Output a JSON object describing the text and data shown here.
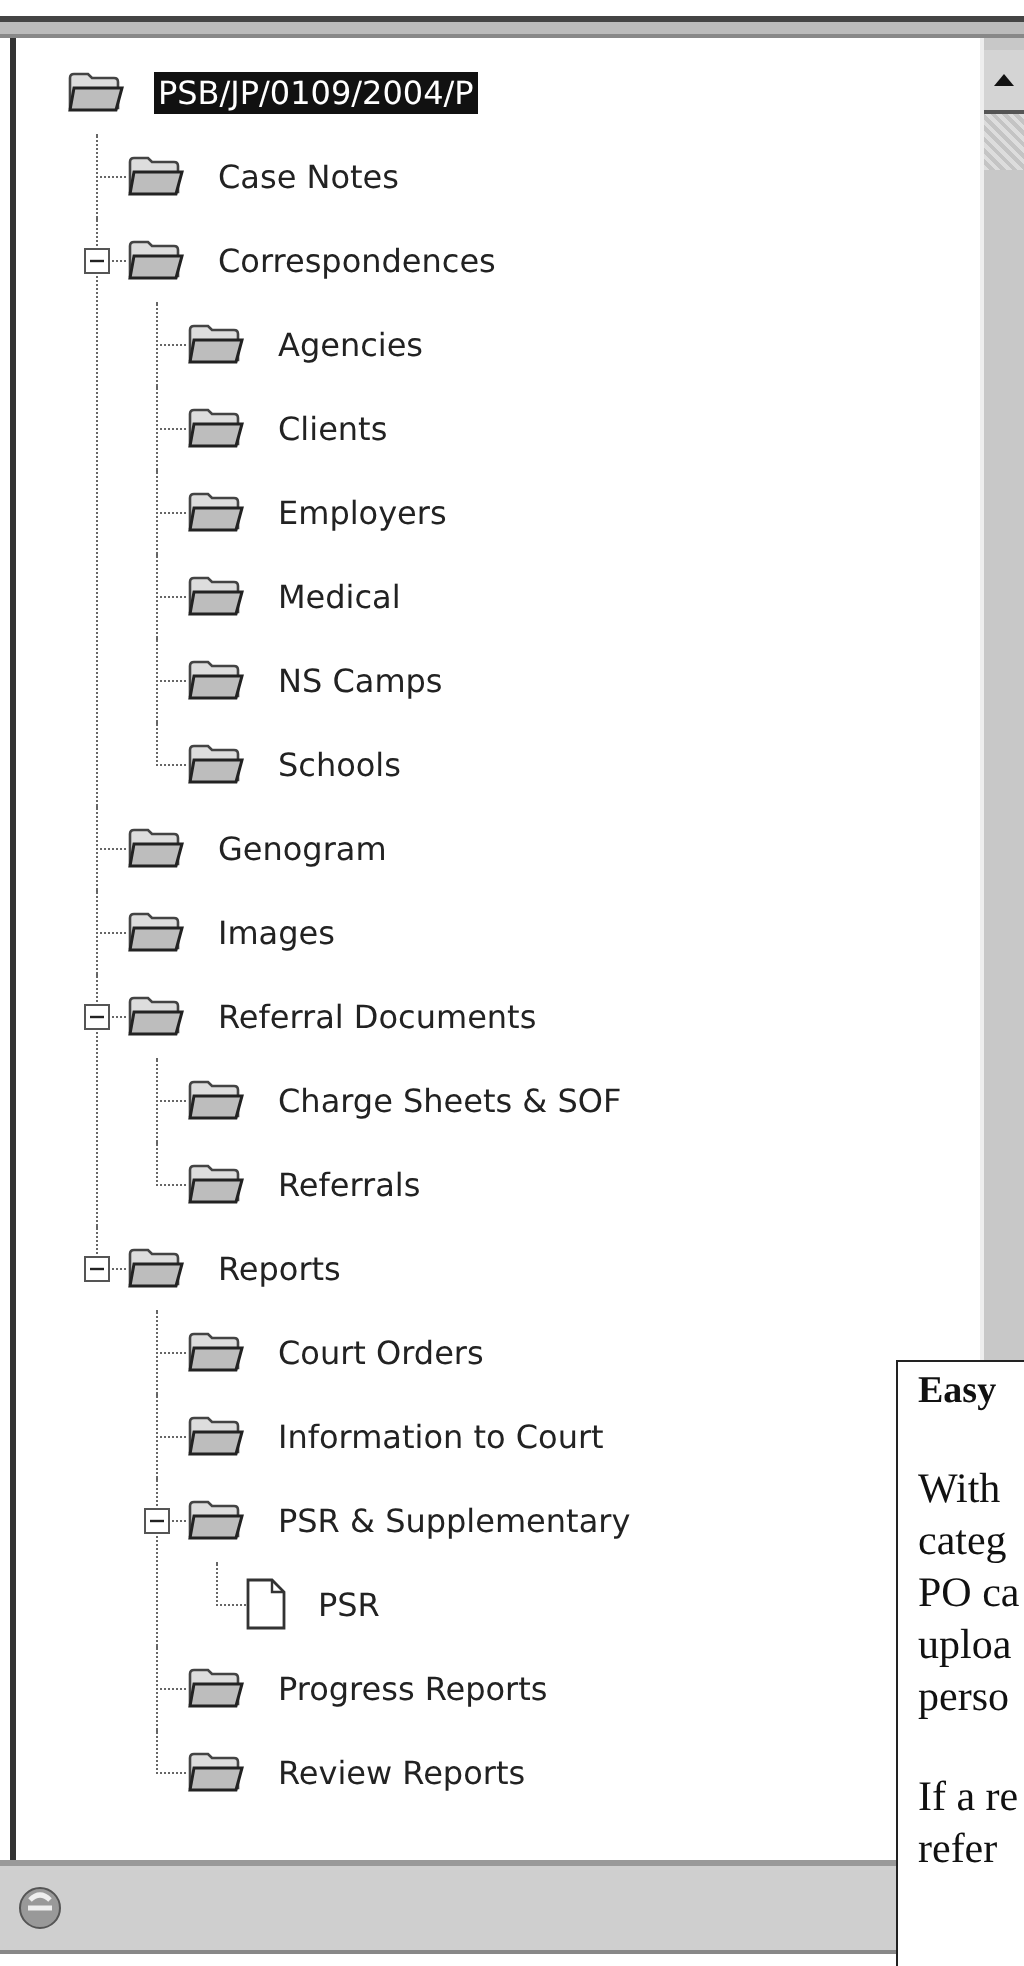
{
  "tree": {
    "label": "PSB/JP/0109/2004/P",
    "kind": "folder",
    "selected": true,
    "children": [
      {
        "label": "Case Notes",
        "kind": "folder",
        "selected": false
      },
      {
        "label": "Correspondences",
        "kind": "folder",
        "selected": false,
        "expanded": true,
        "children": [
          {
            "label": "Agencies",
            "kind": "folder",
            "selected": false
          },
          {
            "label": "Clients",
            "kind": "folder",
            "selected": false
          },
          {
            "label": "Employers",
            "kind": "folder",
            "selected": false
          },
          {
            "label": "Medical",
            "kind": "folder",
            "selected": false
          },
          {
            "label": "NS Camps",
            "kind": "folder",
            "selected": false
          },
          {
            "label": "Schools",
            "kind": "folder",
            "selected": false
          }
        ]
      },
      {
        "label": "Genogram",
        "kind": "folder",
        "selected": false
      },
      {
        "label": "Images",
        "kind": "folder",
        "selected": false
      },
      {
        "label": "Referral Documents",
        "kind": "folder",
        "selected": false,
        "expanded": true,
        "children": [
          {
            "label": "Charge Sheets & SOF",
            "kind": "folder",
            "selected": false
          },
          {
            "label": "Referrals",
            "kind": "folder",
            "selected": false
          }
        ]
      },
      {
        "label": "Reports",
        "kind": "folder",
        "selected": false,
        "expanded": true,
        "children": [
          {
            "label": "Court Orders",
            "kind": "folder",
            "selected": false
          },
          {
            "label": "Information to Court",
            "kind": "folder",
            "selected": false
          },
          {
            "label": "PSR & Supplementary",
            "kind": "folder",
            "selected": false,
            "expanded": true,
            "children": [
              {
                "label": "PSR",
                "kind": "document",
                "selected": false
              }
            ]
          },
          {
            "label": "Progress Reports",
            "kind": "folder",
            "selected": false
          },
          {
            "label": "Review Reports",
            "kind": "folder",
            "selected": false
          }
        ]
      }
    ]
  },
  "callout": {
    "title": "Easy",
    "paragraphs": [
      [
        "With",
        "categ",
        "PO ca",
        "uploa",
        "perso"
      ],
      [
        "If a re",
        "refer"
      ]
    ]
  }
}
